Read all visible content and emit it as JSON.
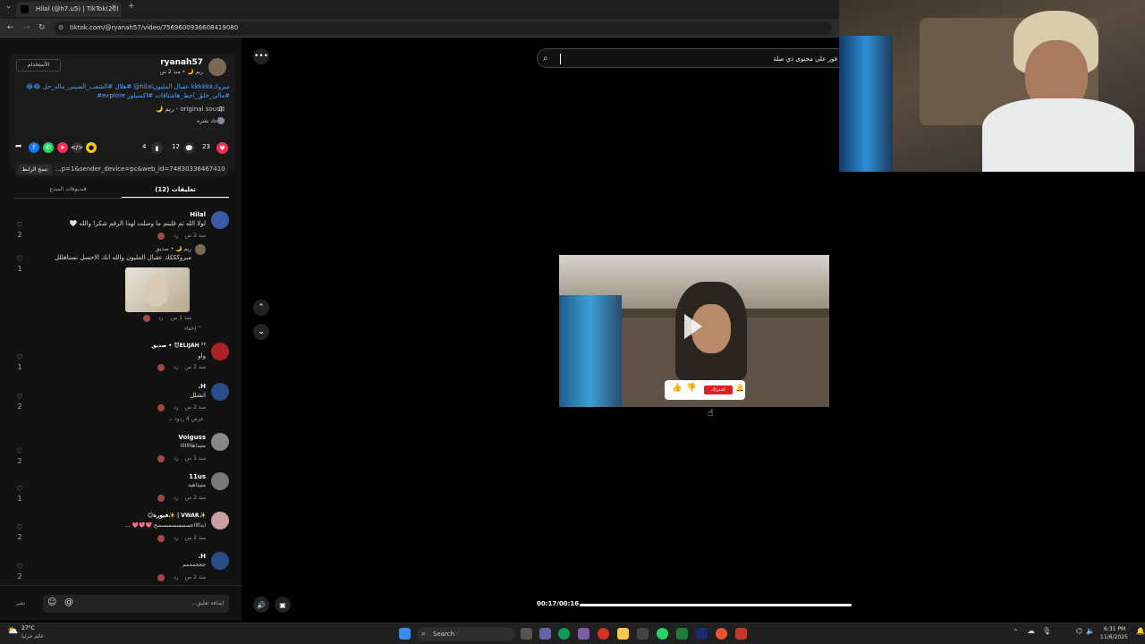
{
  "browser": {
    "tab_title": "Hilal (@h7.u5) | TikTok(20)",
    "url": "tiktok.com/@ryanah57/video/7569600936608419080"
  },
  "post": {
    "username": "ryanah57",
    "subline": "ريم 🌙 • منذ 2 س",
    "follow_label": "الأستخدام",
    "caption_line1": "مبروكkkkkkk عقبال المليونhilal@ #هلال #الشعب_الصيني_ماله_حل 😂😂",
    "caption_line2": "#مالي_خلق_احط_هاشتاقات #اكسبلور explore#",
    "sound": "original sound - ريم 🌙",
    "shares_text": "3 أعاد نشره",
    "like_count": "23",
    "comment_count": "12",
    "save_count": "4",
    "link_text": "...p=1&sender_device=pc&web_id=7483033646741063175",
    "copy_link_label": "نسخ الرابط"
  },
  "tabs": {
    "comments": "تعليقات (12)",
    "creator_videos": "فيديوهات المبدع"
  },
  "comments": [
    {
      "name": "Hilal",
      "text": "لولا الله ثم قلبتم ما وصلت لهذا الرقم شكرا والله 🤍",
      "meta": "منذ 2 س",
      "reply": "رد",
      "likes": "2"
    },
    {
      "name": "ريم 🌙 • صديق",
      "text": "مبروكككك عقبال المليون والله انك الاحسل تستاهللل",
      "meta": "منذ 1 س",
      "reply": "رد",
      "likes": "1",
      "has_image": true
    },
    {
      "name": "ELIJAH ⁷⁷😈 • صديق",
      "text": "واو",
      "meta": "منذ 2 س",
      "reply": "رد",
      "likes": "1"
    },
    {
      "name": "H.",
      "text": "اتشلل",
      "meta": "منذ 2 س",
      "reply": "رد",
      "likes": "2",
      "replies_label": "عرض 4 ردود"
    },
    {
      "name": "Voiguss",
      "text": "متيذاهاااااااا",
      "meta": "منذ 1 س",
      "reply": "رد",
      "likes": "2"
    },
    {
      "name": "11us",
      "text": "متيذاهيه",
      "meta": "منذ 2 س",
      "reply": "رد",
      "likes": "1"
    },
    {
      "name": "✨VWAR | ✨فيوره😊",
      "text": "ايذااااعسسسسسسسح 💖💖💖 ...",
      "meta": "منذ 2 س",
      "reply": "رد",
      "likes": "2"
    },
    {
      "name": "H.",
      "text": "جججمممم",
      "meta": "منذ 2 س",
      "reply": "رد",
      "likes": "2"
    }
  ],
  "hide_label": "إخفاء",
  "comment_input_placeholder": "إضافة تعليق...",
  "post_button": "نشر",
  "search_text": "فور على محتوى ذي صلة",
  "video": {
    "time": "00:17/00:16",
    "progress": 1.0,
    "subscribe_label": "اشتراك"
  },
  "taskbar": {
    "weather_temp": "27°C",
    "weather_text": "غائم جزئيا",
    "search_label": "Search",
    "clock_time": "6:31 PM",
    "clock_date": "11/6/2025"
  },
  "colors": {
    "like": "#fe2c55",
    "tag": "#4da3ff",
    "facebook": "#1877f2",
    "whatsapp": "#25d366"
  }
}
